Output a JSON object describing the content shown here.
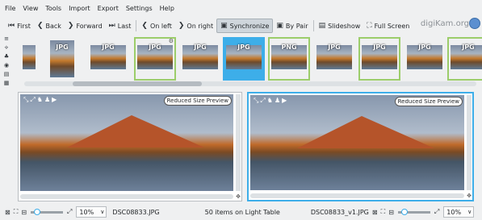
{
  "menu": [
    "File",
    "View",
    "Tools",
    "Import",
    "Export",
    "Settings",
    "Help"
  ],
  "toolbar": {
    "first": "First",
    "back": "Back",
    "forward": "Forward",
    "last": "Last",
    "on_left": "On left",
    "on_right": "On right",
    "synchronize": "Synchronize",
    "by_pair": "By Pair",
    "slideshow": "Slideshow",
    "full_screen": "Full Screen",
    "logo": "digiKam.org"
  },
  "thumbnails": [
    {
      "ext": "",
      "state": "normal"
    },
    {
      "ext": "JPG",
      "state": "normal"
    },
    {
      "ext": "JPG",
      "state": "normal"
    },
    {
      "ext": "JPG",
      "state": "green"
    },
    {
      "ext": "JPG",
      "state": "normal"
    },
    {
      "ext": "JPG",
      "state": "blue"
    },
    {
      "ext": "PNG",
      "state": "green"
    },
    {
      "ext": "JPG",
      "state": "normal"
    },
    {
      "ext": "JPG",
      "state": "green"
    },
    {
      "ext": "JPG",
      "state": "normal"
    },
    {
      "ext": "JPG",
      "state": "green"
    }
  ],
  "left_panel": {
    "badge": "Reduced Size Preview"
  },
  "right_panel": {
    "badge": "Reduced Size Preview"
  },
  "status": {
    "left_zoom": "10%",
    "left_file": "DSC08833.JPG",
    "count": "50 items on Light Table",
    "right_file": "DSC08833_v1.JPG",
    "right_zoom": "10%"
  }
}
